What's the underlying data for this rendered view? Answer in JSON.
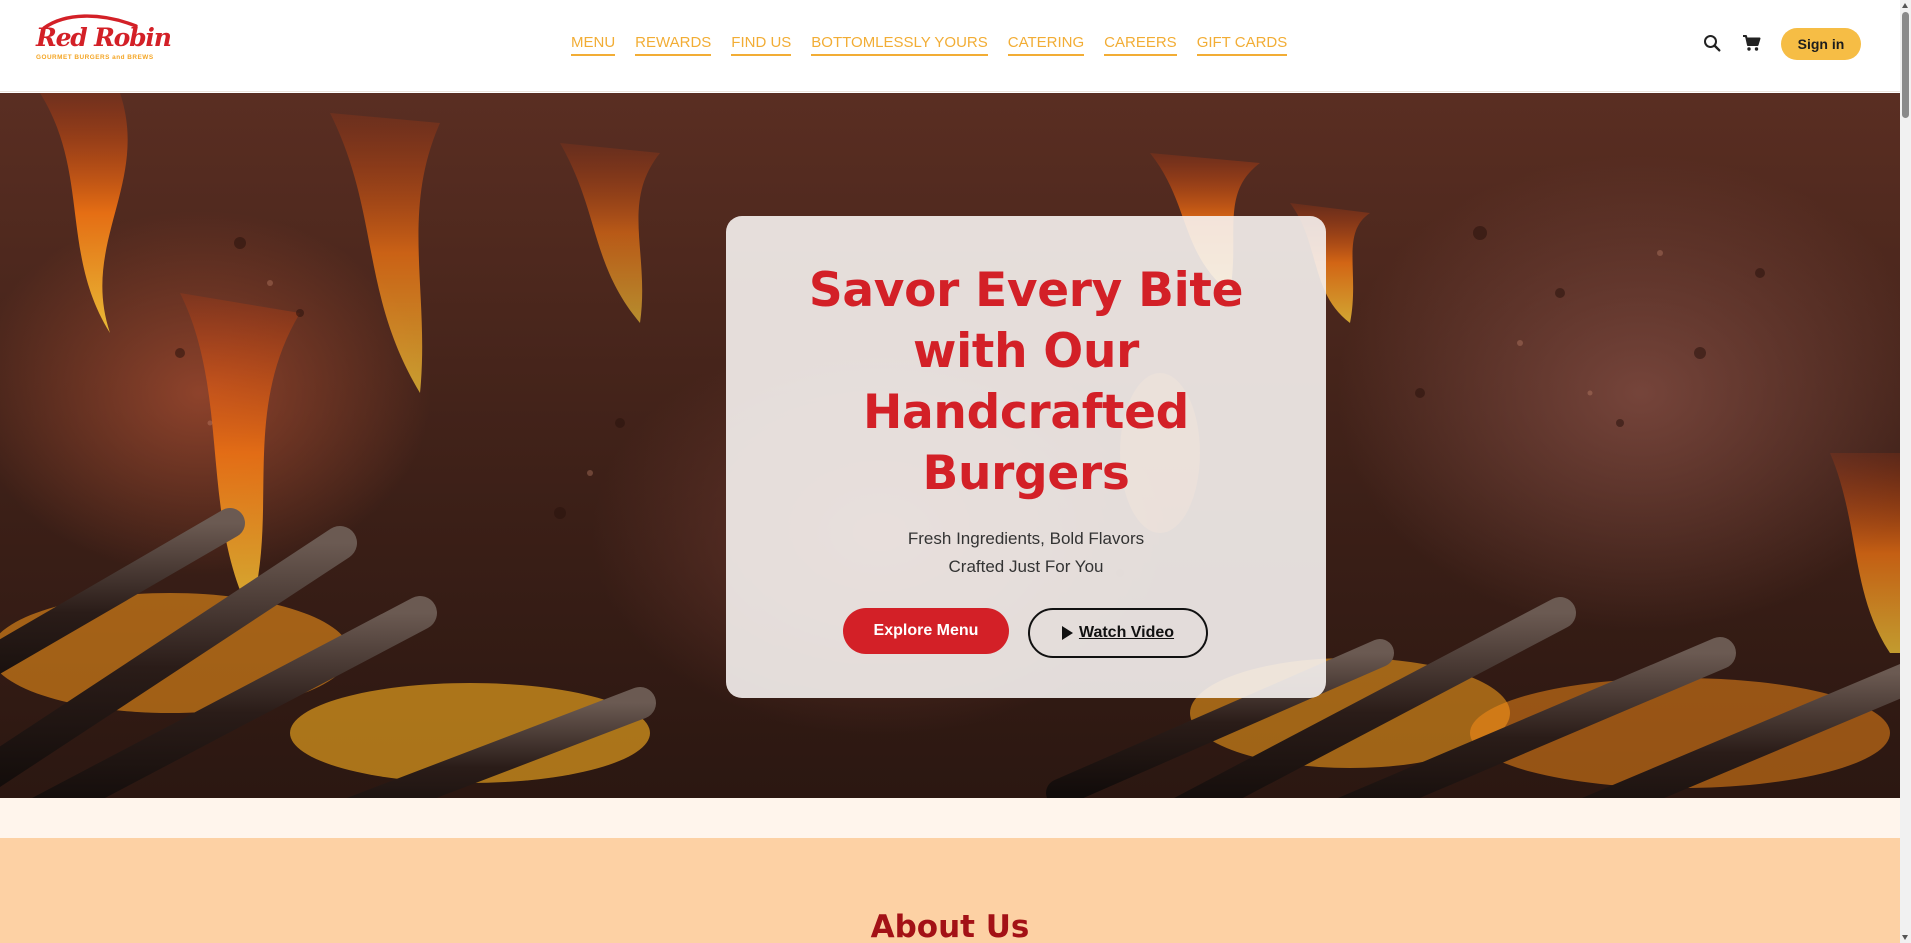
{
  "brand": {
    "name": "Red Robin",
    "tagline": "GOURMET BURGERS and BREWS",
    "primary_color": "#d32027",
    "accent_color": "#f2ad35"
  },
  "nav": {
    "items": [
      {
        "label": "MENU"
      },
      {
        "label": "REWARDS"
      },
      {
        "label": "FIND US"
      },
      {
        "label": "BOTTOMLESSLY YOURS"
      },
      {
        "label": "CATERING"
      },
      {
        "label": "CAREERS"
      },
      {
        "label": "GIFT CARDS"
      }
    ]
  },
  "header_actions": {
    "search_icon": "search-icon",
    "cart_icon": "cart-icon",
    "sign_in_label": "Sign in"
  },
  "hero": {
    "title_lines": [
      "Savor Every Bite",
      "with Our",
      "Handcrafted",
      "Burgers"
    ],
    "subtitle_lines": [
      "Fresh Ingredients, Bold Flavors",
      "Crafted Just For You"
    ],
    "primary_button": "Explore Menu",
    "secondary_button": "Watch Video",
    "secondary_icon": "play-icon"
  },
  "about": {
    "title": "About Us"
  }
}
